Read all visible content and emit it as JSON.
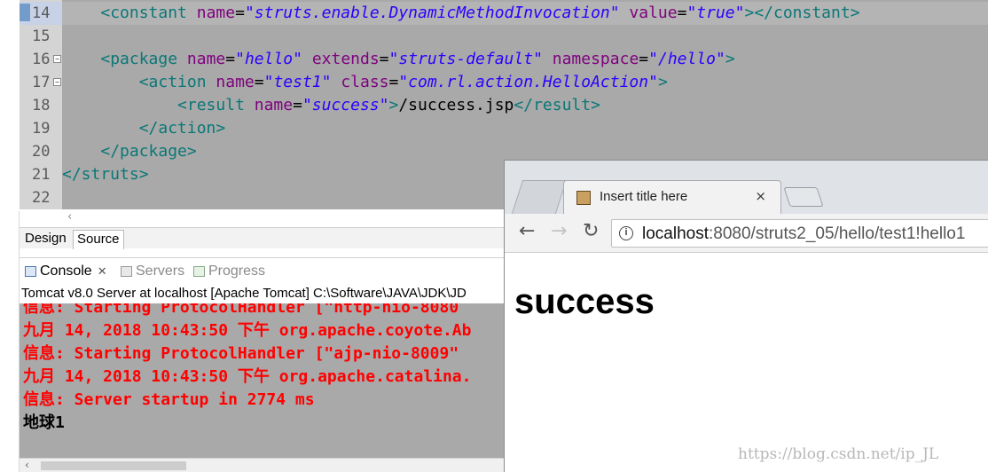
{
  "editor": {
    "lines": [
      {
        "num": "14",
        "indent": "    ",
        "parts": [
          [
            "tag",
            "<constant "
          ],
          [
            "attr",
            "name"
          ],
          [
            "txt",
            "="
          ],
          [
            "val",
            "\"struts.enable.DynamicMethodInvocation\""
          ],
          [
            "txt",
            " "
          ],
          [
            "attr",
            "value"
          ],
          [
            "txt",
            "="
          ],
          [
            "val",
            "\"true\""
          ],
          [
            "tag",
            "></constant>"
          ]
        ],
        "current": true
      },
      {
        "num": "15",
        "indent": "",
        "parts": []
      },
      {
        "num": "16",
        "indent": "    ",
        "parts": [
          [
            "tag",
            "<package "
          ],
          [
            "attr",
            "name"
          ],
          [
            "txt",
            "="
          ],
          [
            "val",
            "\"hello\""
          ],
          [
            "txt",
            " "
          ],
          [
            "attr",
            "extends"
          ],
          [
            "txt",
            "="
          ],
          [
            "val",
            "\"struts-default\""
          ],
          [
            "txt",
            " "
          ],
          [
            "attr",
            "namespace"
          ],
          [
            "txt",
            "="
          ],
          [
            "val",
            "\"/hello\""
          ],
          [
            "tag",
            ">"
          ]
        ],
        "fold": "−"
      },
      {
        "num": "17",
        "indent": "        ",
        "parts": [
          [
            "tag",
            "<action "
          ],
          [
            "attr",
            "name"
          ],
          [
            "txt",
            "="
          ],
          [
            "val",
            "\"test1\""
          ],
          [
            "txt",
            " "
          ],
          [
            "attr",
            "class"
          ],
          [
            "txt",
            "="
          ],
          [
            "val",
            "\"com.rl.action.HelloAction\""
          ],
          [
            "tag",
            ">"
          ]
        ],
        "fold": "−"
      },
      {
        "num": "18",
        "indent": "            ",
        "parts": [
          [
            "tag",
            "<result "
          ],
          [
            "attr",
            "name"
          ],
          [
            "txt",
            "="
          ],
          [
            "val",
            "\"success\""
          ],
          [
            "tag",
            ">"
          ],
          [
            "txt",
            "/success.jsp"
          ],
          [
            "tag",
            "</result>"
          ]
        ]
      },
      {
        "num": "19",
        "indent": "        ",
        "parts": [
          [
            "tag",
            "</action>"
          ]
        ]
      },
      {
        "num": "20",
        "indent": "    ",
        "parts": [
          [
            "tag",
            "</package>"
          ]
        ]
      },
      {
        "num": "21",
        "indent": "",
        "parts": [
          [
            "tag",
            "</struts>"
          ]
        ]
      },
      {
        "num": "22",
        "indent": "",
        "parts": []
      }
    ],
    "view_tabs": {
      "design": "Design",
      "source": "Source"
    }
  },
  "console": {
    "tabs": {
      "console": "Console",
      "servers": "Servers",
      "progress": "Progress"
    },
    "server_line": "Tomcat v8.0 Server at localhost [Apache Tomcat] C:\\Software\\JAVA\\JDK\\JD",
    "lines": [
      {
        "text": "信息: Starting ProtocolHandler [\"http-nio-8080",
        "kind": "err"
      },
      {
        "text": "九月 14, 2018 10:43:50 下午 org.apache.coyote.Ab",
        "kind": "err"
      },
      {
        "text": "信息: Starting ProtocolHandler [\"ajp-nio-8009\"",
        "kind": "err"
      },
      {
        "text": "九月 14, 2018 10:43:50 下午 org.apache.catalina.",
        "kind": "err"
      },
      {
        "text": "信息: Server startup in 2774 ms",
        "kind": "err"
      },
      {
        "text": "地球1",
        "kind": "out"
      }
    ]
  },
  "browser": {
    "tab_title": "Insert title here",
    "tab_close": "×",
    "nav": {
      "back": "←",
      "forward": "→",
      "reload": "↻"
    },
    "info_icon": "i",
    "url_host": "localhost",
    "url_path": ":8080/struts2_05/hello/test1!hello1",
    "page_heading": "success"
  },
  "watermark": "https://blog.csdn.net/ip_JL"
}
